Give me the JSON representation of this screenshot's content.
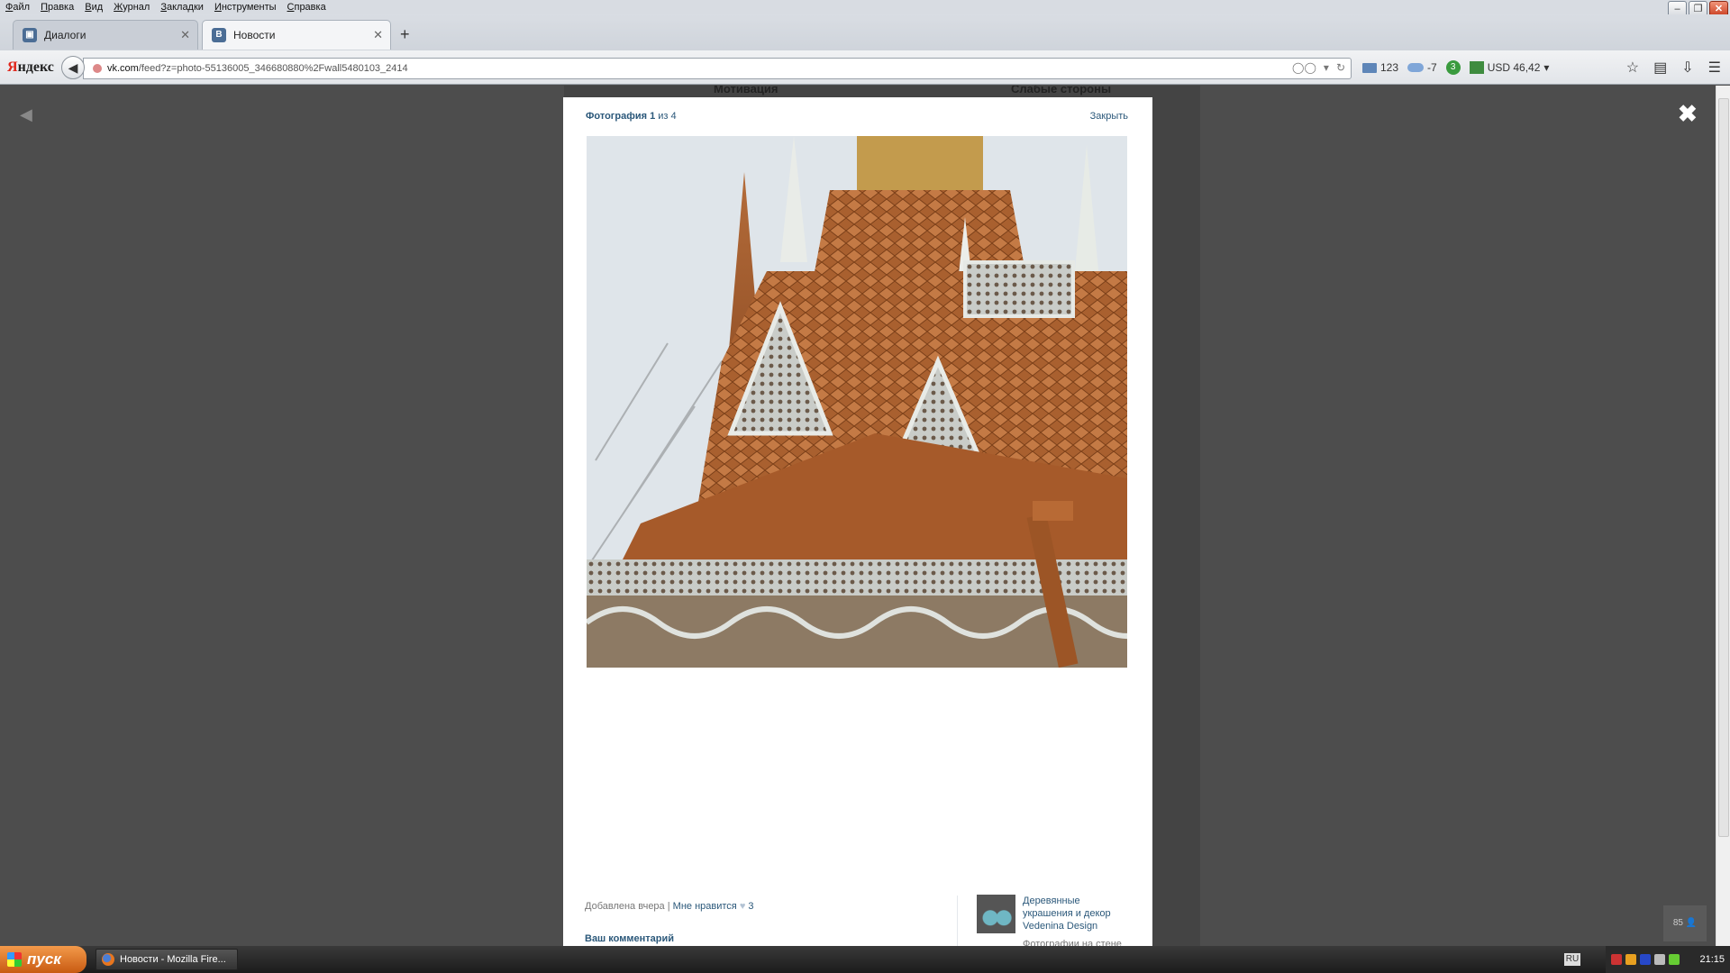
{
  "menu": [
    "Файл",
    "Правка",
    "Вид",
    "Журнал",
    "Закладки",
    "Инструменты",
    "Справка"
  ],
  "tabs": [
    {
      "label": "Диалоги",
      "icon": "vk-messages-icon"
    },
    {
      "label": "Новости",
      "icon": "vk-icon",
      "active": true
    }
  ],
  "nav": {
    "brand_y": "Я",
    "brand_rest": "ндекс",
    "url_domain": "vk.com",
    "url_rest": "/feed?z=photo-55136005_346680880%2Fwall5480103_2414"
  },
  "widgets": {
    "mail_count": "123",
    "weather": "-7",
    "badge": "3",
    "currency": "USD 46,42"
  },
  "background_feed": {
    "text1": "Мотивация",
    "text2": "Слабые стороны"
  },
  "photo_viewer": {
    "counter_label": "Фотография",
    "counter_value": "1",
    "counter_of": "из 4",
    "close_label": "Закрыть",
    "added": "Добавлена вчера",
    "separator": "|",
    "like_label": "Мне нравится",
    "like_count": "3",
    "comment_label": "Ваш комментарий",
    "album_title": "Деревянные украшения и декор Vedenina Design",
    "album_sub": "Фотографии на стене сообщества"
  },
  "online_count": "85",
  "taskbar": {
    "start": "пуск",
    "task": "Новости - Mozilla Fire...",
    "lang": "RU",
    "time": "21:15"
  }
}
